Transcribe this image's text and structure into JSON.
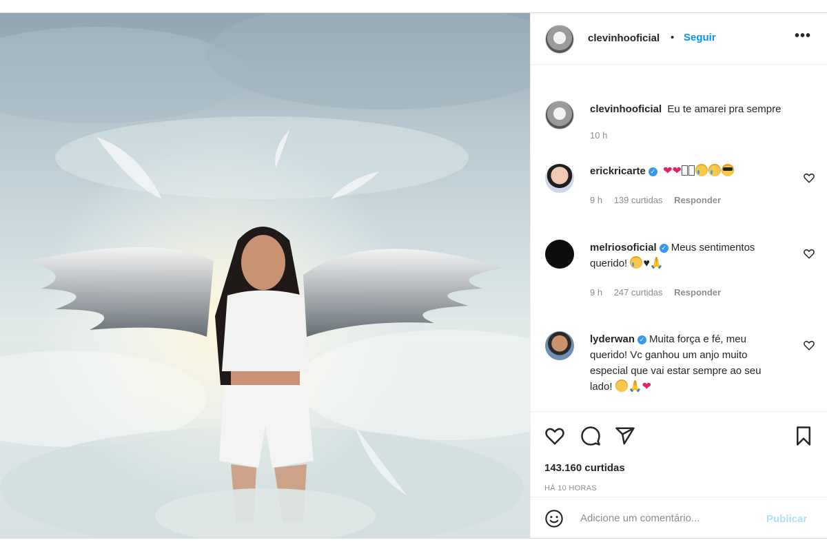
{
  "post": {
    "author": "clevinhooficial",
    "separator": "•",
    "follow_label": "Seguir",
    "more_label": "•••",
    "caption": "Eu te amarei pra sempre",
    "caption_time": "10 h",
    "likes": "143.160 curtidas",
    "posted_ago": "HÁ 10 HORAS"
  },
  "comments": [
    {
      "username": "erickricarte",
      "verified": true,
      "time": "9 h",
      "likes": "139 curtidas",
      "reply_label": "Responder",
      "emojis": [
        "broken-heart",
        "broken-heart",
        "missing-glyph",
        "missing-glyph",
        "crying-face",
        "crying-face",
        "sunglasses-face"
      ]
    },
    {
      "username": "melriosoficial",
      "verified": true,
      "text_line1": "Meus sentimentos",
      "text_line2": "querido!",
      "time": "9 h",
      "likes": "247 curtidas",
      "reply_label": "Responder",
      "emojis": [
        "crying-face",
        "black-heart",
        "folded-hands"
      ]
    },
    {
      "username": "lyderwan",
      "verified": true,
      "text_line1": "Muita força e fé, meu",
      "text_line2": "querido! Vc ganhou um anjo muito",
      "text_line3": "especial que vai estar sempre ao seu",
      "text_line4": "lado!",
      "emojis": [
        "sad-face",
        "folded-hands",
        "red-heart"
      ]
    }
  ],
  "composer": {
    "placeholder": "Adicione um comentário...",
    "publish_label": "Publicar"
  },
  "colors": {
    "link_blue": "#0095f6",
    "publish_disabled": "#b2dffc",
    "muted_text": "#8e8e8e",
    "verified_blue": "#3897f0"
  }
}
